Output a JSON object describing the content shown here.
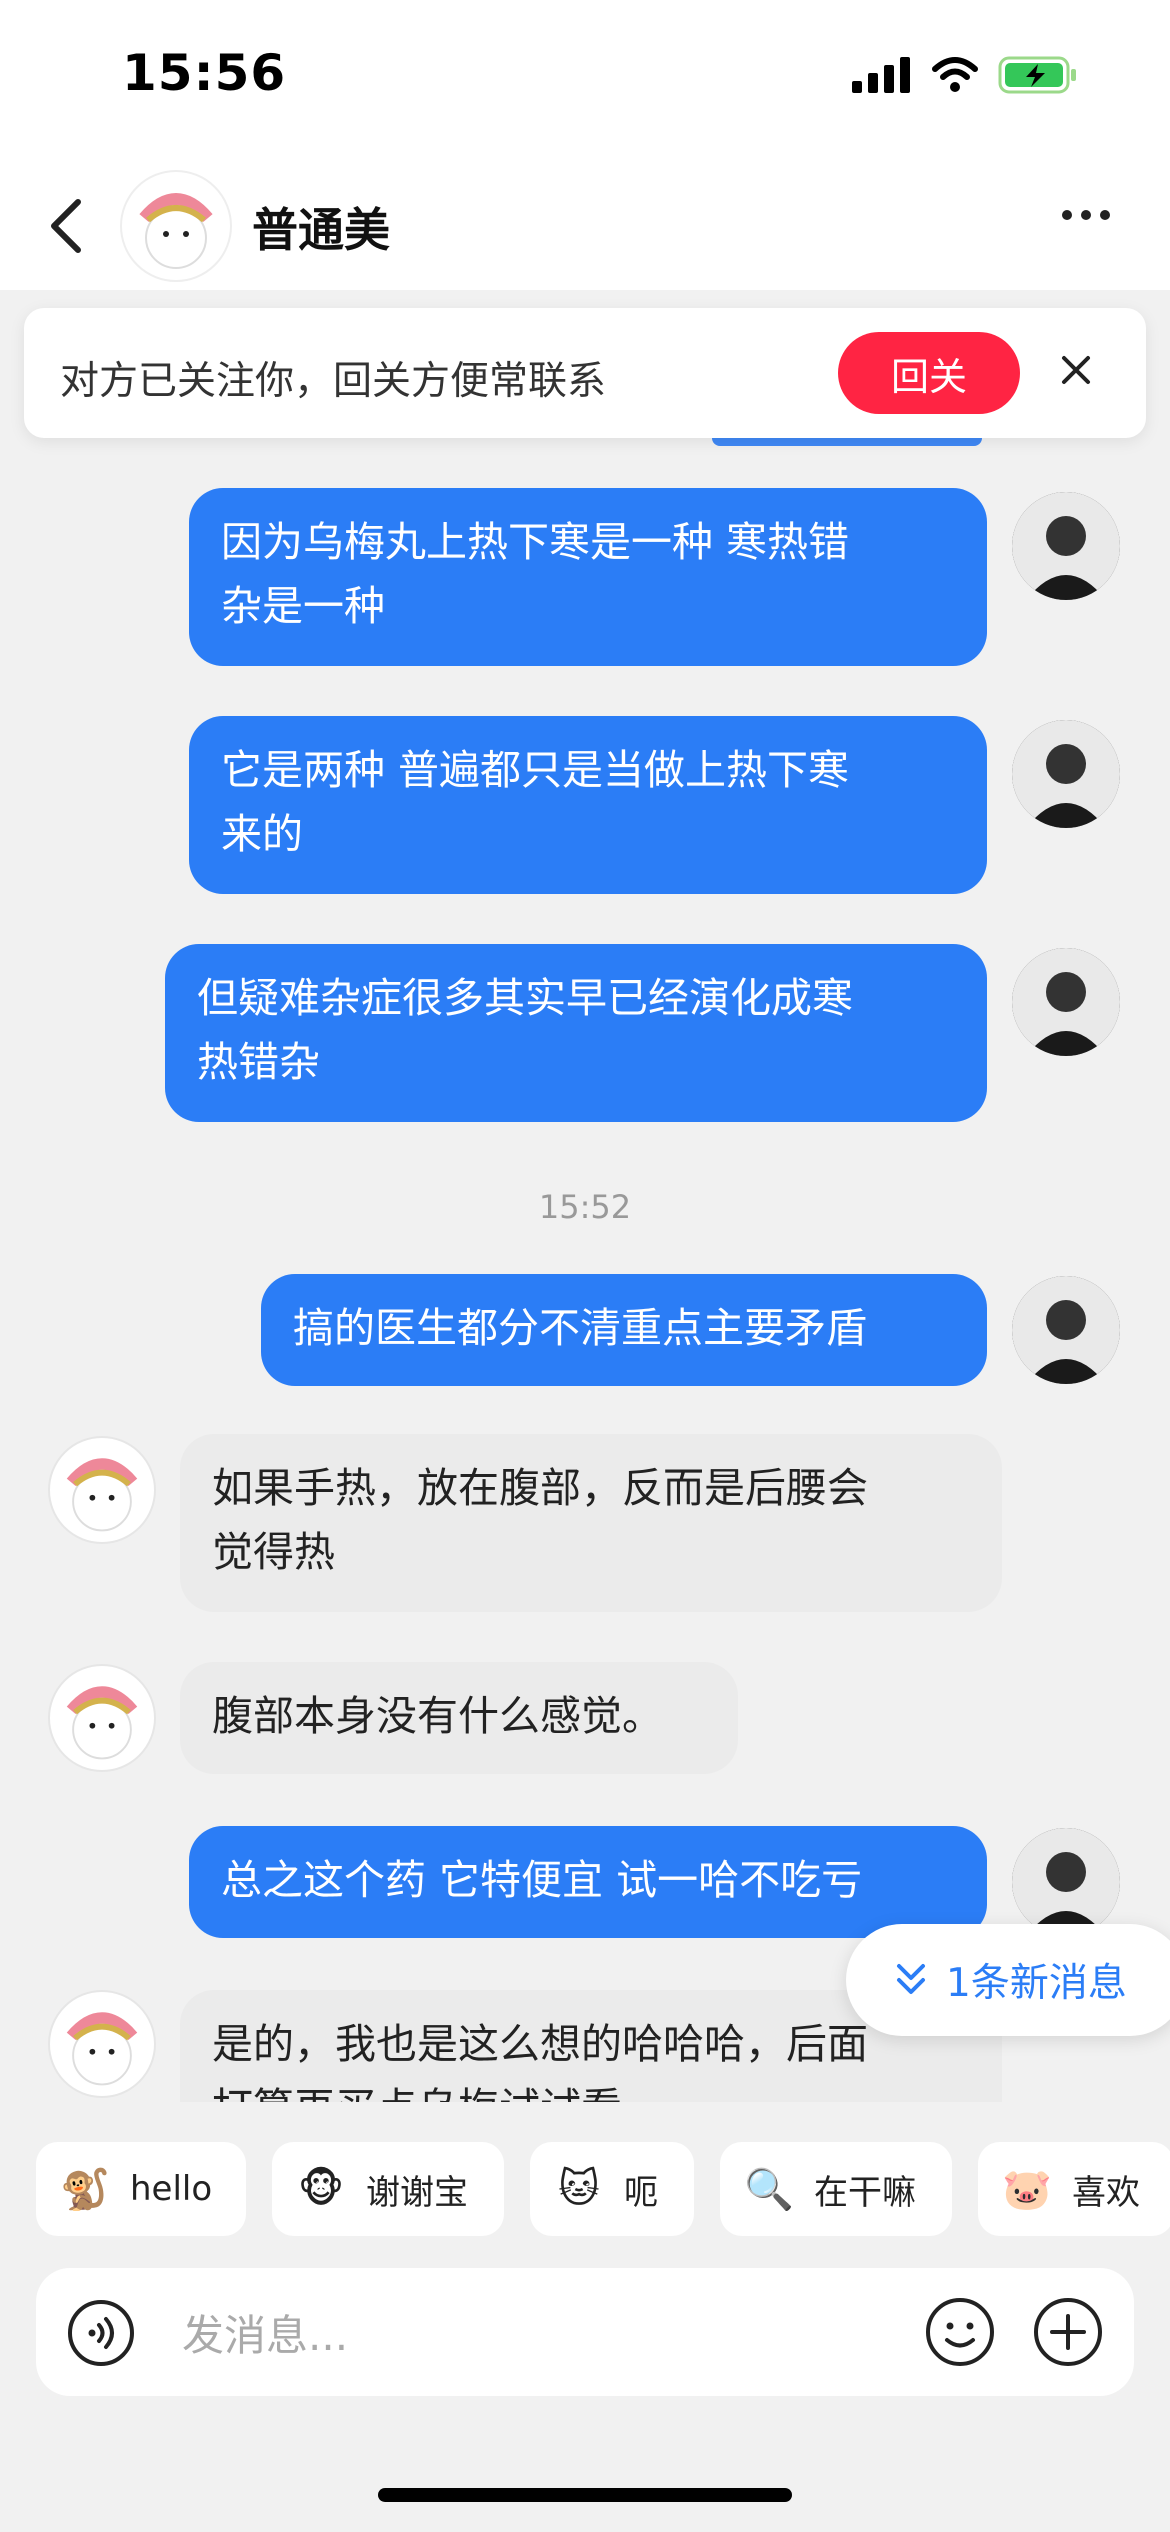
{
  "status_bar": {
    "time": "15:56"
  },
  "header": {
    "contact_name": "普通美"
  },
  "banner": {
    "text": "对方已关注你，回关方便常联系",
    "follow_label": "回关"
  },
  "messages": [
    {
      "from": "me",
      "lines": [
        "因为乌梅丸上热下寒是一种  寒热错",
        "杂是一种"
      ]
    },
    {
      "from": "me",
      "lines": [
        "它是两种  普遍都只是当做上热下寒",
        "来的"
      ]
    },
    {
      "from": "me",
      "lines": [
        "但疑难杂症很多其实早已经演化成寒",
        "热错杂"
      ]
    },
    {
      "from": "me",
      "lines": [
        "搞的医生都分不清重点主要矛盾"
      ]
    },
    {
      "from": "other",
      "lines": [
        "如果手热，放在腹部，反而是后腰会",
        "觉得热"
      ]
    },
    {
      "from": "other",
      "lines": [
        "腹部本身没有什么感觉。"
      ]
    },
    {
      "from": "me",
      "lines": [
        "总之这个药 它特便宜 试一哈不吃亏"
      ]
    },
    {
      "from": "other",
      "lines": [
        "是的，我也是这么想的哈哈哈，后面",
        "打算再买点乌梅试试看"
      ]
    }
  ],
  "timestamp": "15:52",
  "new_message_pill": {
    "label": "1条新消息",
    "icon": "chevrons-down-icon"
  },
  "quick_replies": [
    {
      "label": "hello",
      "emoji": "🐒"
    },
    {
      "label": "谢谢宝",
      "emoji": "🐵"
    },
    {
      "label": "呃",
      "emoji": "🐱"
    },
    {
      "label": "在干嘛",
      "emoji": "🔍"
    },
    {
      "label": "喜欢",
      "emoji": "🐷"
    }
  ],
  "input": {
    "placeholder": "发消息..."
  },
  "colors": {
    "accent": "#2b7df6",
    "follow": "#ff2443",
    "background": "#f1f1f1"
  }
}
